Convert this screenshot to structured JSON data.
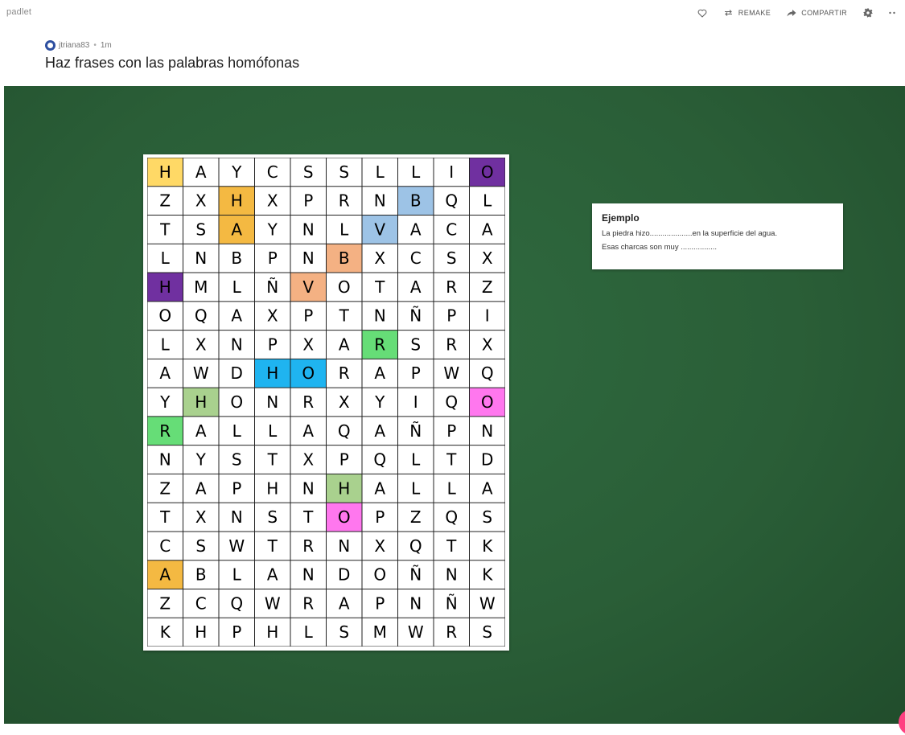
{
  "app": {
    "brand": "padlet"
  },
  "toolbar": {
    "like_icon": "heart-icon",
    "remake_label": "REMAKE",
    "share_label": "COMPARTIR",
    "settings_icon": "gear-icon",
    "more_icon": "ellipsis-icon",
    "icon_color": "#666666"
  },
  "post": {
    "author": "jtriana83",
    "time": "1m",
    "title": "Haz frases con las palabras homófonas"
  },
  "board": {
    "background": "#2a5e37"
  },
  "grid": {
    "rows": [
      [
        "H",
        "A",
        "Y",
        "C",
        "S",
        "S",
        "L",
        "L",
        "I",
        "O"
      ],
      [
        "Z",
        "X",
        "H",
        "X",
        "P",
        "R",
        "N",
        "B",
        "Q",
        "L"
      ],
      [
        "T",
        "S",
        "A",
        "Y",
        "N",
        "L",
        "V",
        "A",
        "C",
        "A"
      ],
      [
        "L",
        "N",
        "B",
        "P",
        "N",
        "B",
        "X",
        "C",
        "S",
        "X"
      ],
      [
        "H",
        "M",
        "L",
        "Ñ",
        "V",
        "O",
        "T",
        "A",
        "R",
        "Z"
      ],
      [
        "O",
        "Q",
        "A",
        "X",
        "P",
        "T",
        "N",
        "Ñ",
        "P",
        "I"
      ],
      [
        "L",
        "X",
        "N",
        "P",
        "X",
        "A",
        "R",
        "S",
        "R",
        "X"
      ],
      [
        "A",
        "W",
        "D",
        "H",
        "O",
        "R",
        "A",
        "P",
        "W",
        "Q"
      ],
      [
        "Y",
        "H",
        "O",
        "N",
        "R",
        "X",
        "Y",
        "I",
        "Q",
        "O"
      ],
      [
        "R",
        "A",
        "L",
        "L",
        "A",
        "Q",
        "A",
        "Ñ",
        "P",
        "N"
      ],
      [
        "N",
        "Y",
        "S",
        "T",
        "X",
        "P",
        "Q",
        "L",
        "T",
        "D"
      ],
      [
        "Z",
        "A",
        "P",
        "H",
        "N",
        "H",
        "A",
        "L",
        "L",
        "A"
      ],
      [
        "T",
        "X",
        "N",
        "S",
        "T",
        "O",
        "P",
        "Z",
        "Q",
        "S"
      ],
      [
        "C",
        "S",
        "W",
        "T",
        "R",
        "N",
        "X",
        "Q",
        "T",
        "K"
      ],
      [
        "A",
        "B",
        "L",
        "A",
        "N",
        "D",
        "O",
        "Ñ",
        "N",
        "K"
      ],
      [
        "Z",
        "C",
        "Q",
        "W",
        "R",
        "A",
        "P",
        "N",
        "Ñ",
        "W"
      ],
      [
        "K",
        "H",
        "P",
        "H",
        "L",
        "S",
        "M",
        "W",
        "R",
        "S"
      ]
    ],
    "highlights": [
      {
        "row": 0,
        "col": 0,
        "color": "#ffd966"
      },
      {
        "row": 0,
        "col": 9,
        "color": "#7030a0"
      },
      {
        "row": 1,
        "col": 2,
        "color": "#f4b942"
      },
      {
        "row": 1,
        "col": 7,
        "color": "#9dc3e6"
      },
      {
        "row": 2,
        "col": 2,
        "color": "#f4b942"
      },
      {
        "row": 2,
        "col": 6,
        "color": "#9dc3e6"
      },
      {
        "row": 3,
        "col": 5,
        "color": "#f4b183"
      },
      {
        "row": 4,
        "col": 0,
        "color": "#7030a0"
      },
      {
        "row": 4,
        "col": 4,
        "color": "#f4b183"
      },
      {
        "row": 6,
        "col": 6,
        "color": "#66dd77"
      },
      {
        "row": 7,
        "col": 3,
        "color": "#1fb4f0"
      },
      {
        "row": 7,
        "col": 4,
        "color": "#1fb4f0"
      },
      {
        "row": 8,
        "col": 1,
        "color": "#a9d18e"
      },
      {
        "row": 8,
        "col": 9,
        "color": "#ff77ee"
      },
      {
        "row": 9,
        "col": 0,
        "color": "#66dd77"
      },
      {
        "row": 11,
        "col": 5,
        "color": "#a9d18e"
      },
      {
        "row": 12,
        "col": 5,
        "color": "#ff77ee"
      },
      {
        "row": 14,
        "col": 0,
        "color": "#f4b942"
      }
    ]
  },
  "note": {
    "title": "Ejemplo",
    "line1": "La piedra hizo....................en la superficie del agua.",
    "line2": "Esas charcas son muy ................."
  },
  "fab": {
    "color": "#ff4081"
  }
}
